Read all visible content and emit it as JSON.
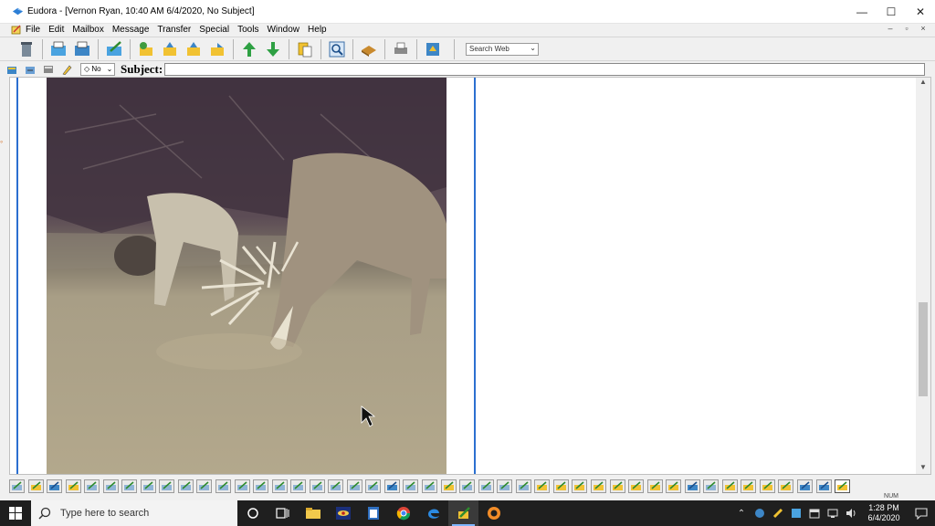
{
  "window": {
    "title": "Eudora - [Vernon Ryan, 10:40 AM 6/4/2020, No Subject]",
    "controls": {
      "minimize": "—",
      "maximize": "☐",
      "close": "✕"
    }
  },
  "menu": {
    "items": [
      "File",
      "Edit",
      "Mailbox",
      "Message",
      "Transfer",
      "Special",
      "Tools",
      "Window",
      "Help"
    ],
    "mdi_controls": [
      "–",
      "▫",
      "×"
    ]
  },
  "toolbar": {
    "search_placeholder": "Search Web",
    "search_arrow": "⌄"
  },
  "subject_bar": {
    "priority_value": "◇ No",
    "priority_arrow": "⌄",
    "subject_label": "Subject:",
    "subject_value": ""
  },
  "message": {
    "image_alt": "Photo of a deer grazing"
  },
  "status": {
    "num_indicator": "NUM"
  },
  "taskbar": {
    "search_placeholder": "Type here to search",
    "time": "1:28 PM",
    "date": "6/4/2020"
  },
  "colors": {
    "rule_blue": "#2b6fd0",
    "taskbar_bg": "#1f1f1f"
  }
}
